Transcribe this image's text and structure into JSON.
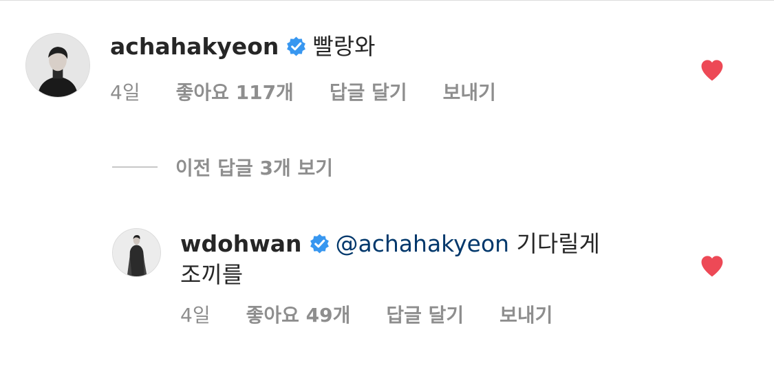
{
  "comment": {
    "username": "achahakyeon",
    "text": "빨랑와",
    "time": "4일",
    "likes": "좋아요 117개",
    "reply": "답글 달기",
    "send": "보내기",
    "liked": true
  },
  "view_previous_replies": "이전 답글 3개 보기",
  "reply": {
    "username": "wdohwan",
    "mention": "@achahakyeon",
    "text_line1": "기다릴게",
    "text_line2": "조끼를",
    "time": "4일",
    "likes": "좋아요 49개",
    "reply": "답글 달기",
    "send": "보내기",
    "liked": true
  },
  "colors": {
    "heart": "#ed4956",
    "verified": "#3897f0",
    "mention": "#00376b",
    "secondary_text": "#8e8e8e"
  }
}
